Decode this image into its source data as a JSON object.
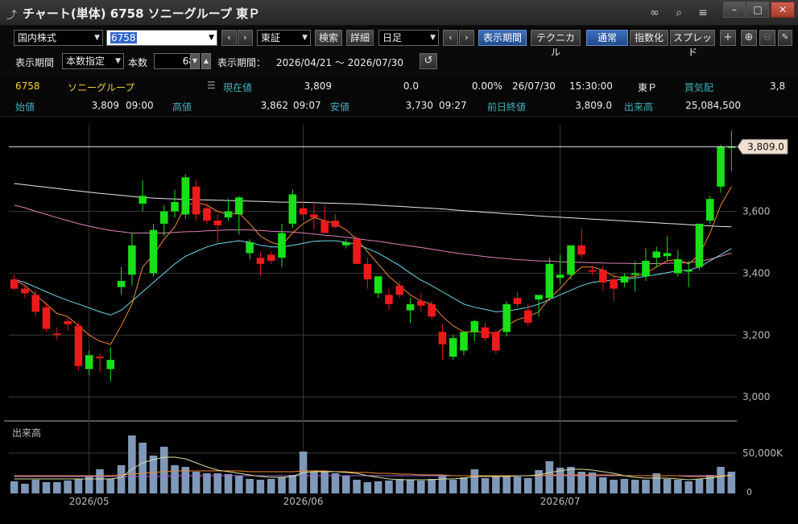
{
  "titlebar": {
    "title": "チャート(単体) 6758 ソニーグループ 東Ｐ",
    "icons": [
      "chart-app-icon",
      "link-icon",
      "search-icon",
      "menu-icon",
      "minimize-icon",
      "maximize-icon",
      "close-icon"
    ]
  },
  "toolbar": {
    "market": "国内株式",
    "symbol": "6758",
    "exchange": "東証",
    "search": "検索",
    "detail": "詳細",
    "interval": "日足",
    "display_period": "表示期間",
    "technical": "テクニカル",
    "normal": "通常",
    "index": "指数化",
    "spread": "スプレッド",
    "period_label": "表示期間",
    "period_mode": "本数指定",
    "count_label": "本数",
    "count": "68",
    "range_label": "表示期間：",
    "range": "2026/04/21 ～ 2026/07/30"
  },
  "quote": {
    "code": "6758",
    "name": "ソニーグループ",
    "current_label": "現在値",
    "current": "3,809",
    "change": "0.0",
    "change_pct": "0.00%",
    "date": "26/07/30",
    "time": "15:30:00",
    "market": "東Ｐ",
    "bidask_label": "買気配",
    "bidask": "3,8",
    "open_label": "始値",
    "open": "3,809",
    "open_time": "09:00",
    "high_label": "高値",
    "high": "3,862",
    "high_time": "09:07",
    "low_label": "安値",
    "low": "3,730",
    "low_time": "09:27",
    "prev_label": "前日終値",
    "prev": "3,809.0",
    "volume_label": "出来高",
    "volume": "25,084,500"
  },
  "colors": {
    "up": "#19e019",
    "down": "#ee1a1a",
    "ma_fast": "#f08a30",
    "ma_mid": "#70d8e8",
    "ma_slow": "#e080b8",
    "ma_long": "#e8e8e8",
    "volume": "#8098b8",
    "price_tag_bg": "#f0e0d0"
  },
  "chart_data": {
    "type": "candlestick",
    "y_ticks": [
      "3,000",
      "3,200",
      "3,400",
      "3,600"
    ],
    "ylim": [
      2930,
      3880
    ],
    "price_tag": "3,809.0",
    "x_labels": [
      {
        "label": "2026/05",
        "index": 7
      },
      {
        "label": "2026/06",
        "index": 27
      },
      {
        "label": "2026/07",
        "index": 51
      }
    ],
    "candles": [
      [
        3380,
        3395,
        3345,
        3350
      ],
      [
        3350,
        3365,
        3320,
        3335
      ],
      [
        3330,
        3345,
        3260,
        3275
      ],
      [
        3290,
        3305,
        3210,
        3220
      ],
      [
        3205,
        3225,
        3185,
        3200
      ],
      [
        3245,
        3255,
        3215,
        3235
      ],
      [
        3230,
        3240,
        3085,
        3100
      ],
      [
        3090,
        3150,
        3070,
        3135
      ],
      [
        3130,
        3140,
        3080,
        3125
      ],
      [
        3090,
        3160,
        3050,
        3120
      ],
      [
        3355,
        3420,
        3330,
        3375
      ],
      [
        3395,
        3530,
        3360,
        3490
      ],
      [
        3625,
        3700,
        3600,
        3650
      ],
      [
        3400,
        3560,
        3390,
        3540
      ],
      [
        3560,
        3620,
        3520,
        3600
      ],
      [
        3600,
        3670,
        3580,
        3630
      ],
      [
        3590,
        3720,
        3575,
        3710
      ],
      [
        3680,
        3700,
        3570,
        3590
      ],
      [
        3610,
        3625,
        3560,
        3570
      ],
      [
        3570,
        3590,
        3500,
        3555
      ],
      [
        3580,
        3640,
        3570,
        3600
      ],
      [
        3590,
        3650,
        3525,
        3645
      ],
      [
        3465,
        3510,
        3445,
        3500
      ],
      [
        3450,
        3470,
        3390,
        3430
      ],
      [
        3460,
        3470,
        3430,
        3440
      ],
      [
        3450,
        3560,
        3420,
        3530
      ],
      [
        3560,
        3670,
        3545,
        3655
      ],
      [
        3610,
        3630,
        3570,
        3590
      ],
      [
        3590,
        3625,
        3540,
        3580
      ],
      [
        3570,
        3620,
        3530,
        3530
      ],
      [
        3570,
        3590,
        3545,
        3550
      ],
      [
        3490,
        3510,
        3480,
        3500
      ],
      [
        3510,
        3520,
        3430,
        3430
      ],
      [
        3430,
        3450,
        3350,
        3380
      ],
      [
        3335,
        3380,
        3320,
        3390
      ],
      [
        3330,
        3350,
        3280,
        3300
      ],
      [
        3360,
        3375,
        3320,
        3330
      ],
      [
        3280,
        3320,
        3240,
        3300
      ],
      [
        3310,
        3335,
        3275,
        3295
      ],
      [
        3300,
        3310,
        3250,
        3260
      ],
      [
        3210,
        3235,
        3120,
        3170
      ],
      [
        3130,
        3200,
        3120,
        3190
      ],
      [
        3150,
        3205,
        3135,
        3210
      ],
      [
        3210,
        3250,
        3180,
        3245
      ],
      [
        3225,
        3240,
        3180,
        3190
      ],
      [
        3210,
        3215,
        3140,
        3150
      ],
      [
        3210,
        3310,
        3195,
        3300
      ],
      [
        3320,
        3340,
        3290,
        3300
      ],
      [
        3280,
        3300,
        3230,
        3240
      ],
      [
        3315,
        3325,
        3260,
        3330
      ],
      [
        3320,
        3450,
        3310,
        3430
      ],
      [
        3385,
        3460,
        3365,
        3395
      ],
      [
        3395,
        3470,
        3380,
        3490
      ],
      [
        3490,
        3545,
        3450,
        3460
      ],
      [
        3410,
        3425,
        3395,
        3405
      ],
      [
        3410,
        3425,
        3345,
        3370
      ],
      [
        3380,
        3400,
        3310,
        3350
      ],
      [
        3370,
        3400,
        3355,
        3390
      ],
      [
        3395,
        3440,
        3340,
        3400
      ],
      [
        3390,
        3480,
        3375,
        3440
      ],
      [
        3450,
        3485,
        3420,
        3470
      ],
      [
        3455,
        3520,
        3440,
        3465
      ],
      [
        3400,
        3475,
        3390,
        3445
      ],
      [
        3405,
        3440,
        3355,
        3410
      ],
      [
        3420,
        3560,
        3410,
        3560
      ],
      [
        3570,
        3650,
        3560,
        3640
      ],
      [
        3680,
        3815,
        3660,
        3809
      ],
      [
        3809,
        3862,
        3730,
        3809
      ]
    ],
    "ma_fast": [
      3380,
      3360,
      3330,
      3300,
      3270,
      3260,
      3230,
      3200,
      3180,
      3170,
      3230,
      3300,
      3420,
      3460,
      3510,
      3550,
      3620,
      3630,
      3620,
      3600,
      3590,
      3595,
      3560,
      3520,
      3500,
      3490,
      3530,
      3560,
      3580,
      3570,
      3560,
      3540,
      3510,
      3470,
      3430,
      3390,
      3360,
      3330,
      3310,
      3300,
      3260,
      3230,
      3210,
      3210,
      3210,
      3205,
      3230,
      3250,
      3260,
      3275,
      3320,
      3350,
      3390,
      3420,
      3420,
      3410,
      3390,
      3385,
      3390,
      3400,
      3420,
      3440,
      3445,
      3430,
      3460,
      3530,
      3620,
      3680
    ],
    "ma_mid": [
      3380,
      3370,
      3355,
      3340,
      3325,
      3312,
      3300,
      3288,
      3275,
      3265,
      3280,
      3310,
      3340,
      3370,
      3400,
      3430,
      3455,
      3470,
      3485,
      3495,
      3500,
      3505,
      3500,
      3490,
      3485,
      3485,
      3490,
      3497,
      3503,
      3505,
      3505,
      3500,
      3493,
      3480,
      3465,
      3445,
      3425,
      3400,
      3378,
      3360,
      3340,
      3320,
      3300,
      3290,
      3283,
      3275,
      3278,
      3283,
      3290,
      3300,
      3315,
      3330,
      3345,
      3360,
      3370,
      3375,
      3378,
      3380,
      3385,
      3390,
      3395,
      3402,
      3408,
      3410,
      3420,
      3440,
      3460,
      3480
    ],
    "ma_slow": [
      3620,
      3612,
      3600,
      3590,
      3580,
      3570,
      3560,
      3552,
      3545,
      3538,
      3534,
      3530,
      3530,
      3530,
      3530,
      3532,
      3534,
      3535,
      3537,
      3538,
      3540,
      3540,
      3540,
      3538,
      3536,
      3535,
      3533,
      3530,
      3527,
      3523,
      3520,
      3516,
      3512,
      3507,
      3503,
      3498,
      3493,
      3488,
      3483,
      3478,
      3472,
      3467,
      3462,
      3458,
      3454,
      3450,
      3447,
      3444,
      3442,
      3440,
      3439,
      3437,
      3436,
      3435,
      3434,
      3433,
      3432,
      3432,
      3431,
      3431,
      3431,
      3432,
      3433,
      3434,
      3438,
      3445,
      3455,
      3465
    ],
    "ma_long": [
      3690,
      3686,
      3682,
      3678,
      3674,
      3670,
      3666,
      3662,
      3658,
      3655,
      3652,
      3648,
      3645,
      3643,
      3641,
      3640,
      3639,
      3638,
      3637,
      3636,
      3635,
      3634,
      3633,
      3632,
      3631,
      3630,
      3630,
      3629,
      3628,
      3627,
      3626,
      3625,
      3624,
      3622,
      3620,
      3618,
      3616,
      3614,
      3612,
      3610,
      3608,
      3605,
      3602,
      3600,
      3597,
      3595,
      3592,
      3590,
      3588,
      3585,
      3583,
      3581,
      3579,
      3577,
      3575,
      3573,
      3571,
      3569,
      3567,
      3565,
      3563,
      3561,
      3559,
      3557,
      3555,
      3553,
      3551,
      3550
    ],
    "volume_label": "出来高",
    "volume_tick": "50,000K",
    "volume_max": 70000,
    "volumes": [
      15000,
      12000,
      17000,
      14000,
      14000,
      16000,
      18000,
      22000,
      30000,
      18000,
      35000,
      72000,
      63000,
      47000,
      58000,
      35000,
      33000,
      27000,
      25000,
      25000,
      24000,
      22000,
      18000,
      17000,
      18000,
      20000,
      23000,
      52000,
      27000,
      27000,
      25000,
      22000,
      17000,
      14000,
      15000,
      16000,
      18000,
      17000,
      16000,
      18000,
      22000,
      17000,
      20000,
      30000,
      19000,
      21000,
      21000,
      21000,
      19000,
      29000,
      40000,
      32000,
      33000,
      27000,
      26000,
      20000,
      17000,
      18000,
      17000,
      17000,
      25000,
      18000,
      17000,
      15000,
      18000,
      23000,
      33000,
      27000
    ],
    "vol_ma_a": [
      18000,
      18000,
      18000,
      18000,
      18000,
      18000,
      18000,
      18000,
      18000,
      18000,
      20000,
      30000,
      38000,
      42000,
      45000,
      45000,
      43000,
      38000,
      33000,
      29000,
      27000,
      25000,
      23000,
      21000,
      20000,
      20000,
      21000,
      26000,
      27000,
      27000,
      27000,
      26000,
      25000,
      22000,
      20000,
      18000,
      17000,
      17000,
      17000,
      17000,
      18000,
      18000,
      19000,
      21000,
      21000,
      21000,
      21000,
      22000,
      22000,
      23000,
      26000,
      28000,
      30000,
      30000,
      29000,
      27000,
      25000,
      22000,
      20000,
      19000,
      19000,
      19000,
      18000,
      17000,
      18000,
      19000,
      21000,
      23000
    ],
    "vol_ma_b": [
      22000,
      22000,
      22000,
      22000,
      22000,
      22000,
      22000,
      22000,
      22000,
      22000,
      23000,
      24000,
      25000,
      26000,
      27000,
      28000,
      28000,
      28000,
      28000,
      28000,
      28000,
      28000,
      27000,
      27000,
      27000,
      27000,
      27000,
      28000,
      28000,
      28000,
      27000,
      27000,
      26000,
      26000,
      25000,
      25000,
      24000,
      24000,
      23000,
      23000,
      23000,
      22000,
      22000,
      22000,
      22000,
      22000,
      22000,
      22000,
      22000,
      22000,
      23000,
      23000,
      23000,
      23000,
      23000,
      23000,
      23000,
      22000,
      22000,
      22000,
      22000,
      22000,
      22000,
      21000,
      21000,
      21000,
      22000,
      22000
    ],
    "vol_ma_c": [
      21000,
      21000,
      21000,
      21000,
      21000,
      21000,
      21000,
      21000,
      21000,
      21000,
      21000,
      21000,
      21000,
      21000,
      21000,
      22000,
      22000,
      22000,
      22000,
      22000,
      22000,
      22000,
      22000,
      22000,
      22000,
      22000,
      22000,
      22000,
      22000,
      22000,
      22000,
      22000,
      22000,
      22000,
      22000,
      22000,
      22000,
      22000,
      22000,
      22000,
      22000,
      22000,
      22000,
      22000,
      22000,
      22000,
      22000,
      22000,
      22000,
      22000,
      22000,
      22000,
      22000,
      22000,
      22000,
      22000,
      22000,
      22000,
      22000,
      22000,
      22000,
      22000,
      22000,
      22000,
      22000,
      22000,
      22000,
      22000
    ]
  }
}
